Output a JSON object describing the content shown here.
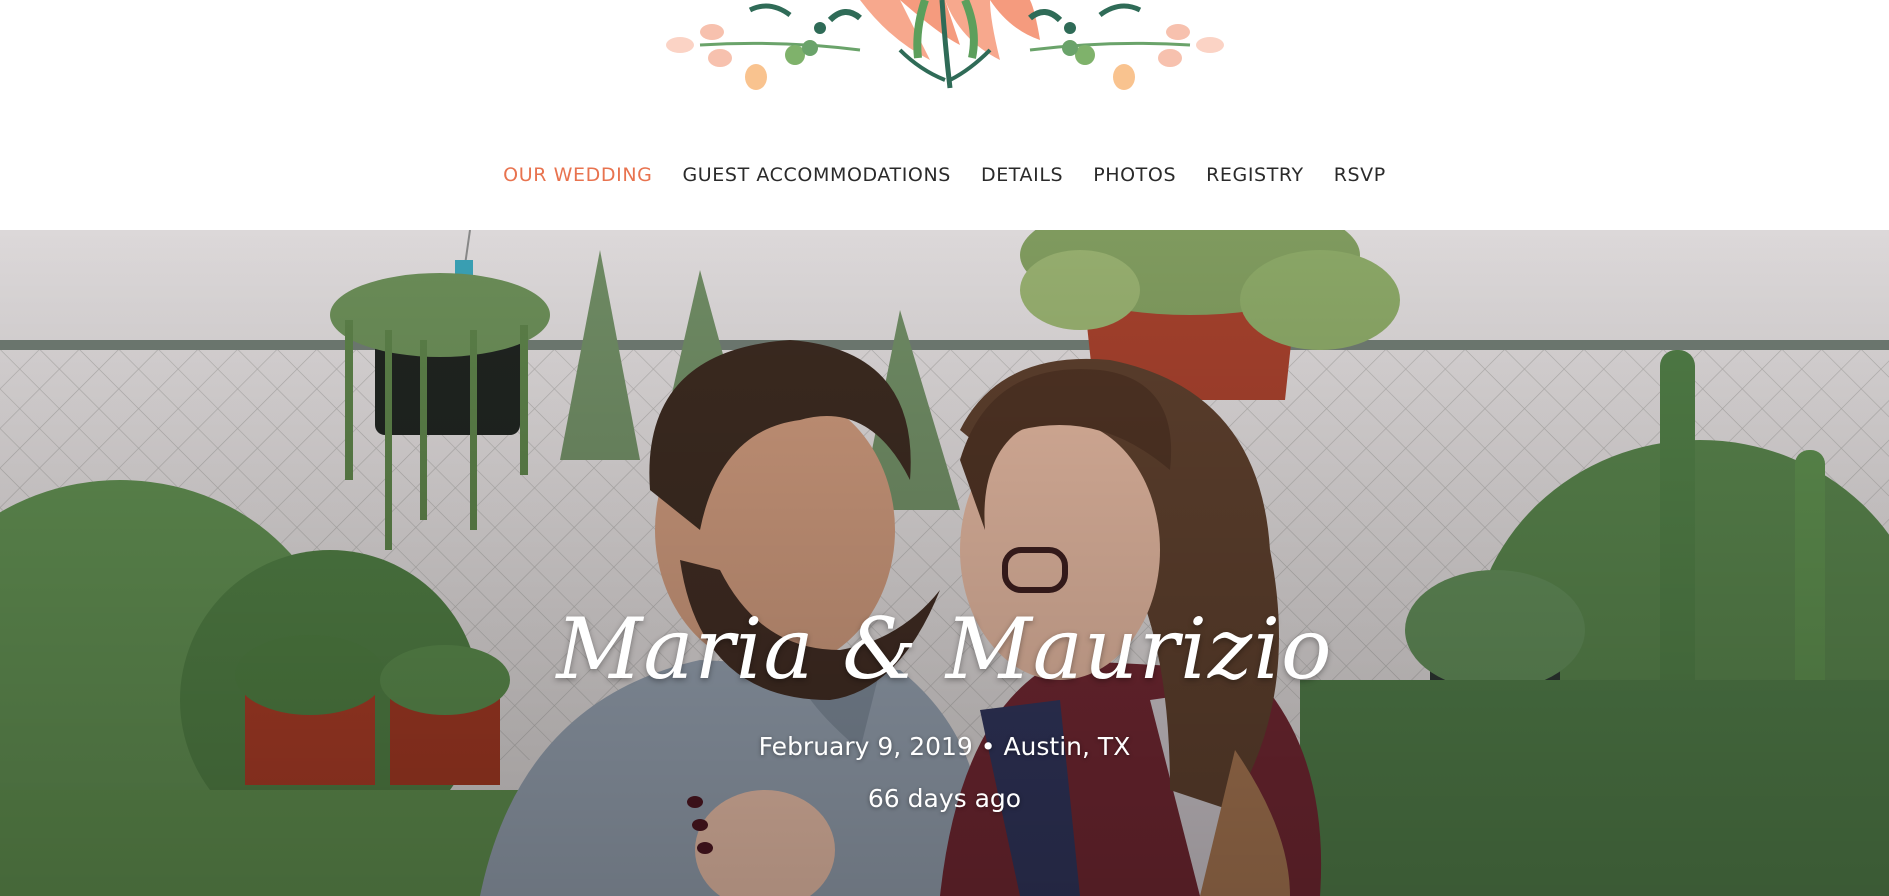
{
  "nav": {
    "items": [
      {
        "label": "OUR WEDDING",
        "active": true
      },
      {
        "label": "GUEST ACCOMMODATIONS",
        "active": false
      },
      {
        "label": "DETAILS",
        "active": false
      },
      {
        "label": "PHOTOS",
        "active": false
      },
      {
        "label": "REGISTRY",
        "active": false
      },
      {
        "label": "RSVP",
        "active": false
      }
    ]
  },
  "hero": {
    "names": "Maria & Maurizio",
    "date_location": "February 9, 2019 • Austin, TX",
    "countdown": "66 days ago"
  },
  "colors": {
    "accent": "#e8734f",
    "nav_text": "#2a2a2a",
    "floral_peach": "#f7a88d",
    "floral_green": "#2f6b57"
  }
}
